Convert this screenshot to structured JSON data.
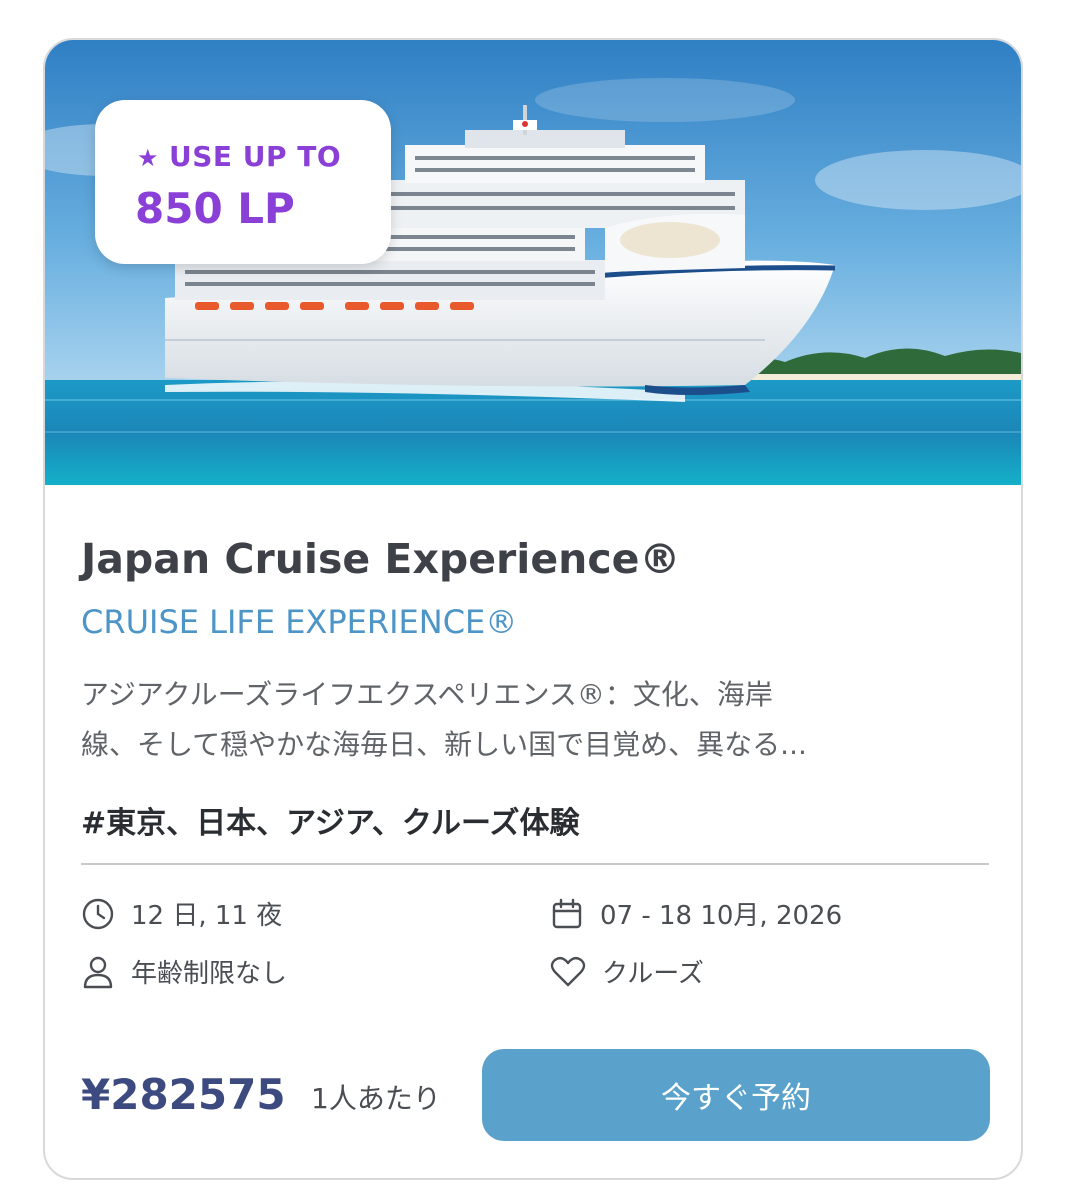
{
  "badge": {
    "label": "USE UP TO",
    "value": "850 LP",
    "star_icon": "star-icon",
    "color": "#8a3fd6"
  },
  "card": {
    "title": "Japan Cruise Experience®",
    "subtitle": "CRUISE LIFE EXPERIENCE®",
    "description_line1": "アジアクルーズライフエクスペリエンス®：文化、海岸",
    "description_line2": "線、そして穏やかな海毎日、新しい国で目覚め、異なる...",
    "tags": "#東京、日本、アジア、クルーズ体験"
  },
  "details": {
    "duration": "12 日, 11 夜",
    "dates": "07 - 18 10月, 2026",
    "age": "年齢制限なし",
    "category": "クルーズ",
    "icons": [
      "clock-icon",
      "calendar-icon",
      "person-icon",
      "heart-icon"
    ]
  },
  "pricing": {
    "price": "¥282575",
    "per_person": "1人あたり",
    "book_label": "今すぐ予約",
    "button_color": "#5aa2cb"
  }
}
